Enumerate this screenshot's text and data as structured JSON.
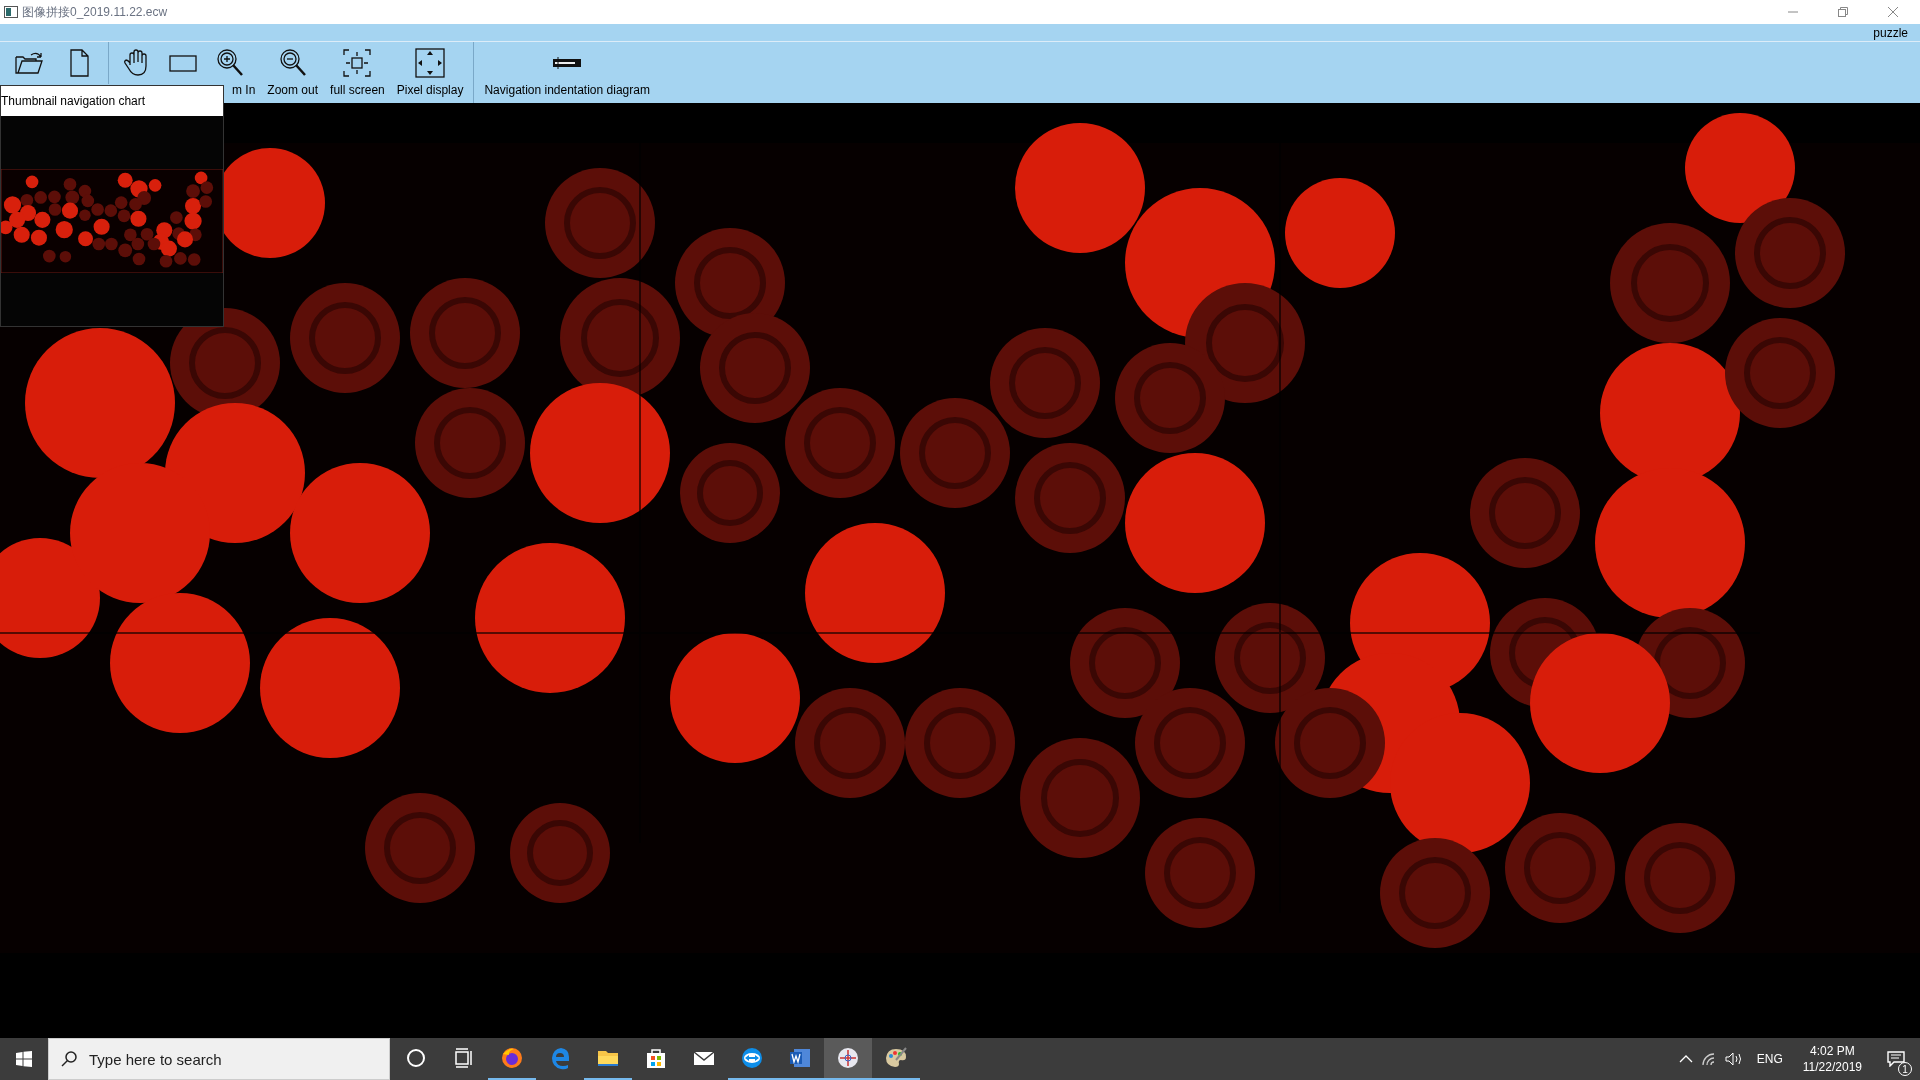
{
  "window": {
    "title": "图像拼接0_2019.11.22.ecw"
  },
  "menu_bar": {
    "label": "puzzle"
  },
  "toolbar": [
    {
      "kind": "open",
      "separator_before": false
    },
    {
      "kind": "file",
      "separator_before": false
    },
    {
      "kind": "hand",
      "separator_before": true
    },
    {
      "kind": "rect",
      "separator_before": false
    },
    {
      "kind": "zoomin",
      "separator_before": false,
      "label": "m In"
    },
    {
      "kind": "zoomout",
      "separator_before": false,
      "label": "Zoom out"
    },
    {
      "kind": "fullscreen",
      "separator_before": false,
      "label": "full screen"
    },
    {
      "kind": "pixel",
      "separator_before": false,
      "label": "Pixel display"
    },
    {
      "kind": "nav",
      "separator_before": true,
      "label": "Navigation indentation diagram"
    }
  ],
  "thumbnail_panel": {
    "title": "Thumbnail navigation chart"
  },
  "taskbar": {
    "search": {
      "placeholder": "Type here to search"
    },
    "apps": [
      {
        "kind": "cortana",
        "running": false,
        "selected": false
      },
      {
        "kind": "taskview",
        "running": false,
        "selected": false
      },
      {
        "kind": "firefox",
        "running": true,
        "selected": false
      },
      {
        "kind": "edge",
        "running": false,
        "selected": false
      },
      {
        "kind": "folder",
        "running": true,
        "selected": false
      },
      {
        "kind": "store",
        "running": false,
        "selected": false
      },
      {
        "kind": "mail",
        "running": false,
        "selected": false
      },
      {
        "kind": "remote",
        "running": true,
        "selected": false
      },
      {
        "kind": "word",
        "running": true,
        "selected": false
      },
      {
        "kind": "viewer",
        "running": true,
        "selected": true
      },
      {
        "kind": "paint",
        "running": true,
        "selected": false
      }
    ],
    "tray": {
      "language": "ENG",
      "time": "4:02 PM",
      "date": "11/22/2019",
      "notifications": "1"
    }
  }
}
